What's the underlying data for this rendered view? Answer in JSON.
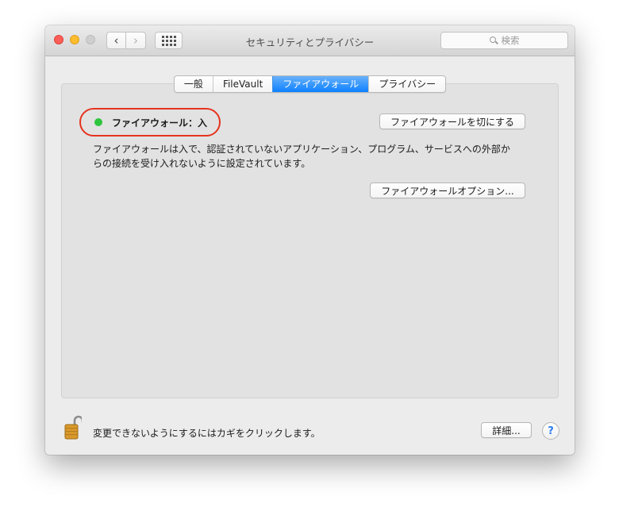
{
  "window": {
    "title": "セキュリティとプライバシー",
    "search_placeholder": "検索"
  },
  "tabs": [
    {
      "label": "一般"
    },
    {
      "label": "FileVault"
    },
    {
      "label": "ファイアウォール",
      "selected": true
    },
    {
      "label": "プライバシー"
    }
  ],
  "firewall": {
    "status_label": "ファイアウォール：入",
    "status_color": "#2fc43e",
    "turn_off_button": "ファイアウォールを切にする",
    "description_line1": "ファイアウォールは入で、認証されていないアプリケーション、プログラム、サービスへの外部か",
    "description_line2": "らの接続を受け入れないように設定されています。",
    "options_button": "ファイアウォールオプション..."
  },
  "footer": {
    "lock_text": "変更できないようにするにはカギをクリックします。",
    "details_button": "詳細...",
    "help_button": "?"
  },
  "colors": {
    "accent": "#0d81ff",
    "highlight_ring": "#e6331e"
  }
}
